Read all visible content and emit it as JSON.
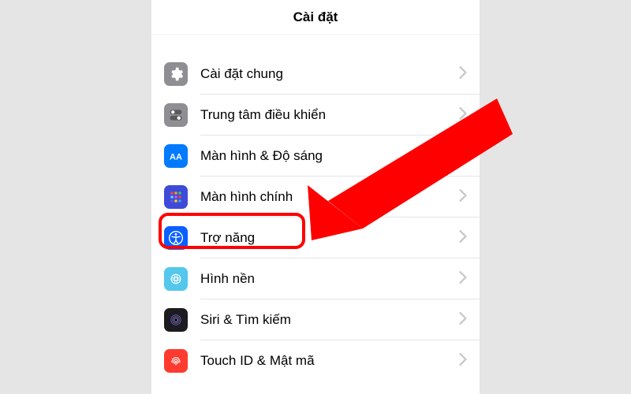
{
  "header": {
    "title": "Cài đặt"
  },
  "rows": [
    {
      "label": "Cài đặt chung"
    },
    {
      "label": "Trung tâm điều khiển"
    },
    {
      "label": "Màn hình & Độ sáng"
    },
    {
      "label": "Màn hình chính"
    },
    {
      "label": "Trợ năng"
    },
    {
      "label": "Hình nền"
    },
    {
      "label": "Siri & Tìm kiếm"
    },
    {
      "label": "Touch ID & Mật mã"
    }
  ],
  "highlight_index": 4
}
